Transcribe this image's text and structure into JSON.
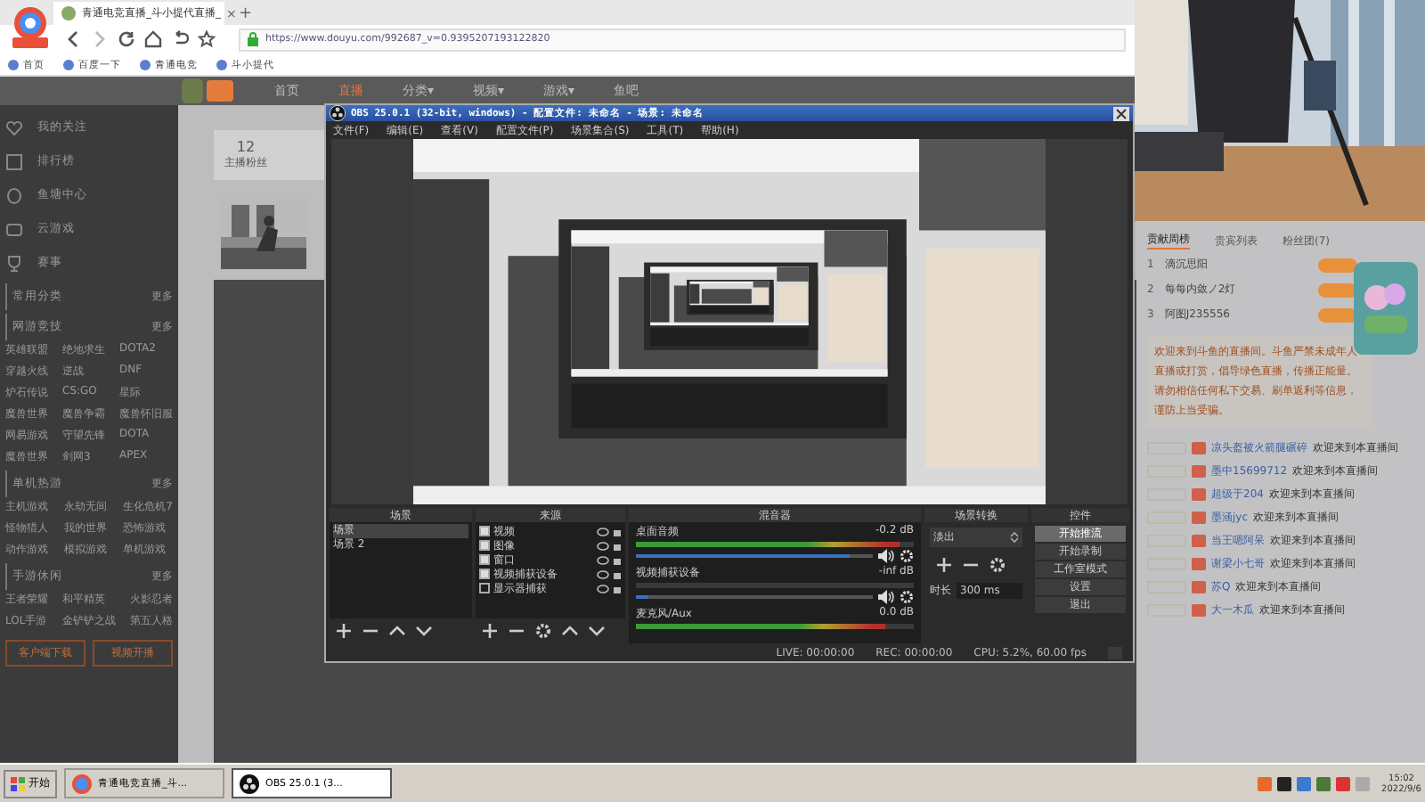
{
  "browser": {
    "tab_title": "青通电竞直播_斗小提代直播_",
    "new_tab": "+",
    "close_tab": "×",
    "url": "https://www.douyu.com/992687_v=0.9395207193122820",
    "bookmarks": [
      "首页",
      "百度一下",
      "青通电竞",
      "斗小提代"
    ],
    "site_nav": [
      {
        "label": "首页",
        "selected": false
      },
      {
        "label": "直播",
        "selected": true
      },
      {
        "label": "分类▾",
        "selected": false
      },
      {
        "label": "视频▾",
        "selected": false
      },
      {
        "label": "游戏▾",
        "selected": false
      },
      {
        "label": "鱼吧",
        "selected": false
      }
    ],
    "sidebar": {
      "items": [
        "我的关注",
        "排行榜",
        "鱼塘中心",
        "云游戏",
        "赛事"
      ],
      "sections": [
        {
          "title": "常用分类",
          "more": "更多"
        },
        {
          "title": "网游竞技",
          "more": "更多",
          "games": [
            "英雄联盟",
            "绝地求生",
            "DOTA2",
            "穿越火线",
            "逆战",
            "DNF",
            "炉石传说",
            "CS:GO",
            "星际",
            "魔兽世界",
            "魔兽争霸",
            "魔兽怀旧服",
            "网易游戏",
            "守望先锋",
            "DOTA",
            "魔兽世界",
            "剑网3",
            "APEX"
          ]
        },
        {
          "title": "单机热游",
          "more": "更多",
          "games": [
            "主机游戏",
            "永劫无间",
            "生化危机7",
            "怪物猎人",
            "我的世界",
            "恐怖游戏",
            "动作游戏",
            "模拟游戏",
            "单机游戏"
          ]
        },
        {
          "title": "手游休闲",
          "more": "更多",
          "games": [
            "王者荣耀",
            "和平精英",
            "火影忍者",
            "LOL手游",
            "金铲铲之战",
            "第五人格"
          ]
        }
      ],
      "buttons": [
        "客户端下载",
        "视频开播"
      ]
    },
    "card": {
      "count": "12",
      "count_label": "主播粉丝"
    },
    "chat": {
      "tabs": [
        {
          "label": "贡献周榜",
          "selected": true
        },
        {
          "label": "贵宾列表",
          "selected": false
        },
        {
          "label": "粉丝团(7)",
          "selected": false
        }
      ],
      "ranks": [
        {
          "rank": "1",
          "name": "滴沉思阳"
        },
        {
          "rank": "2",
          "name": "每每内敛ノ2灯"
        },
        {
          "rank": "3",
          "name": "阿图J235556"
        }
      ],
      "notice": "欢迎来到斗鱼的直播间。斗鱼严禁未成年人直播或打赏，倡导绿色直播，传播正能量。请勿相信任何私下交易、刷单返利等信息，谨防上当受骗。",
      "messages": [
        {
          "name": "凉头盔被火箭腿碾碎",
          "text": "欢迎来到本直播间"
        },
        {
          "name": "墨中15699712",
          "text": "欢迎来到本直播间"
        },
        {
          "name": "超级于204",
          "text": "欢迎来到本直播间"
        },
        {
          "name": "墨涵jyc",
          "text": "欢迎来到本直播间"
        },
        {
          "name": "当王嗯阿呆",
          "text": "欢迎来到本直播间"
        },
        {
          "name": "谢梁小七哥",
          "text": "欢迎来到本直播间"
        },
        {
          "name": "苏Q",
          "text": "欢迎来到本直播间"
        },
        {
          "name": "大一木瓜",
          "text": "欢迎来到本直播间"
        }
      ]
    }
  },
  "obs": {
    "title": "OBS 25.0.1 (32-bit, windows) - 配置文件: 未命名 - 场景: 未命名",
    "menu": [
      "文件(F)",
      "编辑(E)",
      "查看(V)",
      "配置文件(P)",
      "场景集合(S)",
      "工具(T)",
      "帮助(H)"
    ],
    "scenes": {
      "title": "场景",
      "items": [
        {
          "label": "场景",
          "selected": true
        },
        {
          "label": "场景 2",
          "selected": false
        }
      ]
    },
    "sources": {
      "title": "来源",
      "items": [
        {
          "label": "视频",
          "visible": true
        },
        {
          "label": "图像",
          "visible": true
        },
        {
          "label": "窗口",
          "visible": true
        },
        {
          "label": "视频捕获设备",
          "visible": true
        },
        {
          "label": "显示器捕获",
          "visible": false
        }
      ]
    },
    "mixer": {
      "title": "混音器",
      "channels": [
        {
          "name": "桌面音频",
          "reading": "-0.2 dB",
          "meter": {
            "level": 0.95
          },
          "volume": {
            "level": 0.9
          }
        },
        {
          "name": "视频捕获设备",
          "reading": "-inf dB",
          "meter": {
            "level": 0.0
          },
          "volume": {
            "level": 0.05
          }
        },
        {
          "name": "麦克风/Aux",
          "reading": "0.0 dB",
          "meter": {
            "level": 0.9
          }
        }
      ]
    },
    "transitions": {
      "title": "场景转换",
      "type": "淡出",
      "duration_label": "时长",
      "duration": "300 ms"
    },
    "controls": {
      "title": "控件",
      "buttons": [
        {
          "label": "开始推流",
          "selected": true
        },
        {
          "label": "开始录制",
          "selected": false
        },
        {
          "label": "工作室模式",
          "selected": false
        },
        {
          "label": "设置",
          "selected": false
        },
        {
          "label": "退出",
          "selected": false
        }
      ]
    },
    "status": [
      "LIVE: 00:00:00",
      "REC: 00:00:00",
      "CPU: 5.2%, 60.00 fps"
    ]
  },
  "taskbar": {
    "start": "开始",
    "tasks": [
      {
        "label": "青通电竞直播_斗...",
        "selected": false
      },
      {
        "label": "OBS 25.0.1 (3...",
        "selected": true
      }
    ],
    "time": "15:02",
    "date": "2022/9/6"
  }
}
